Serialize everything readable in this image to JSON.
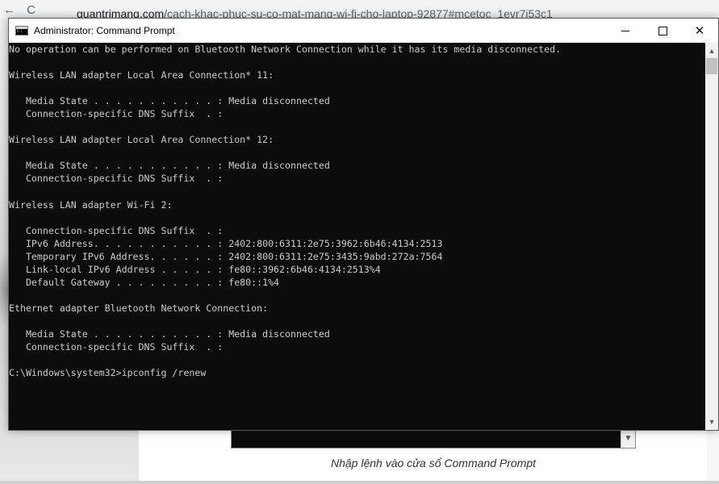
{
  "browser": {
    "nav_back": "←",
    "nav_reload": "C",
    "url_domain": "quantrimang.com",
    "url_path": "/cach-khac-phuc-su-co-mat-mang-wi-fi-cho-laptop-92877#mcetoc_1evr7i53c1",
    "caption": "Nhập lệnh vào cửa sổ Command Prompt"
  },
  "window": {
    "title": "Administrator: Command Prompt",
    "minimize_icon": "minimize-icon",
    "maximize_icon": "maximize-icon",
    "close_icon": "close-icon",
    "close_glyph": "✕"
  },
  "console": {
    "lines": [
      "No operation can be performed on Bluetooth Network Connection while it has its media disconnected.",
      "",
      "Wireless LAN adapter Local Area Connection* 11:",
      "",
      "   Media State . . . . . . . . . . . : Media disconnected",
      "   Connection-specific DNS Suffix  . :",
      "",
      "Wireless LAN adapter Local Area Connection* 12:",
      "",
      "   Media State . . . . . . . . . . . : Media disconnected",
      "   Connection-specific DNS Suffix  . :",
      "",
      "Wireless LAN adapter Wi-Fi 2:",
      "",
      "   Connection-specific DNS Suffix  . :",
      "   IPv6 Address. . . . . . . . . . . : 2402:800:6311:2e75:3962:6b46:4134:2513",
      "   Temporary IPv6 Address. . . . . . : 2402:800:6311:2e75:3435:9abd:272a:7564",
      "   Link-local IPv6 Address . . . . . : fe80::3962:6b46:4134:2513%4",
      "   Default Gateway . . . . . . . . . : fe80::1%4",
      "",
      "Ethernet adapter Bluetooth Network Connection:",
      "",
      "   Media State . . . . . . . . . . . : Media disconnected",
      "   Connection-specific DNS Suffix  . :",
      "",
      "C:\\Windows\\system32>ipconfig /renew"
    ],
    "colors": {
      "background": "#0c0c0c",
      "text": "#cccccc"
    }
  }
}
